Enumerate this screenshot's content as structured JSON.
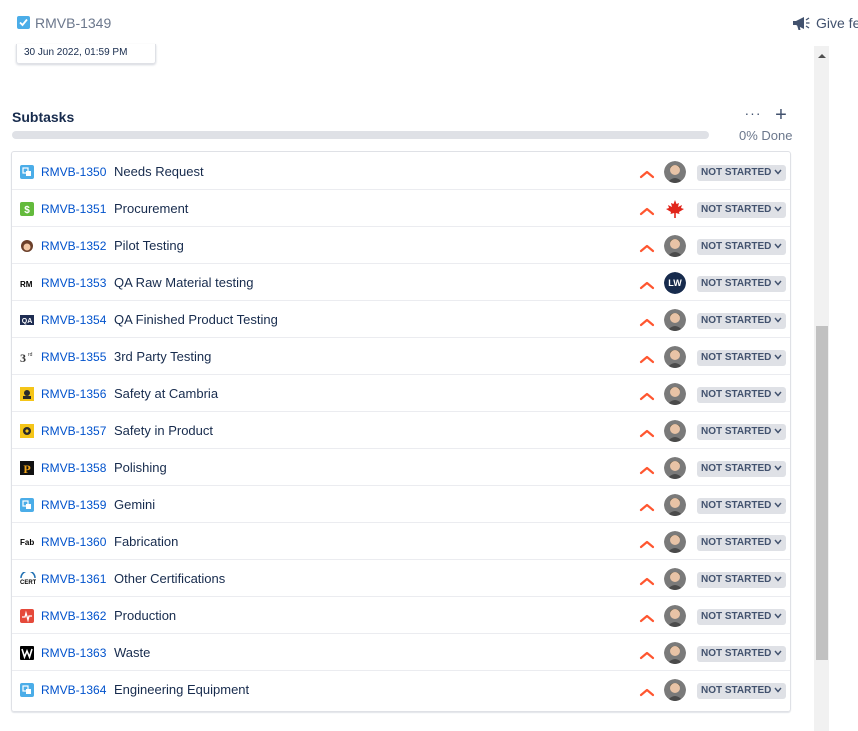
{
  "parent": {
    "key": "RMVB-1349",
    "icon": "checkbox-icon",
    "color": "#4bade8"
  },
  "header": {
    "feedback_label": "Give fee"
  },
  "date_field": {
    "value": "30 Jun 2022, 01:59 PM"
  },
  "subtasks": {
    "title": "Subtasks",
    "more_label": "···",
    "add_label": "+",
    "progress_percent": 0,
    "progress_label": "0% Done",
    "status_color": "#dfe1e6",
    "priority_color": "#ff5630",
    "items": [
      {
        "key": "RMVB-1350",
        "summary": "Needs Request",
        "icon": "subtask-icon",
        "assignee": "avatar",
        "status": "NOT STARTED"
      },
      {
        "key": "RMVB-1351",
        "summary": "Procurement",
        "icon": "dollar-icon",
        "assignee": "canada-flag",
        "status": "NOT STARTED"
      },
      {
        "key": "RMVB-1352",
        "summary": "Pilot Testing",
        "icon": "pilot-icon",
        "assignee": "avatar",
        "status": "NOT STARTED"
      },
      {
        "key": "RMVB-1353",
        "summary": "QA Raw Material testing",
        "icon": "rm-icon",
        "assignee": "LW",
        "status": "NOT STARTED"
      },
      {
        "key": "RMVB-1354",
        "summary": "QA Finished Product Testing",
        "icon": "qa-icon",
        "assignee": "avatar",
        "status": "NOT STARTED"
      },
      {
        "key": "RMVB-1355",
        "summary": "3rd Party Testing",
        "icon": "third-party-icon",
        "assignee": "avatar",
        "status": "NOT STARTED"
      },
      {
        "key": "RMVB-1356",
        "summary": "Safety at Cambria",
        "icon": "safety-icon",
        "assignee": "avatar",
        "status": "NOT STARTED"
      },
      {
        "key": "RMVB-1357",
        "summary": "Safety in Product",
        "icon": "safety-product-icon",
        "assignee": "avatar",
        "status": "NOT STARTED"
      },
      {
        "key": "RMVB-1358",
        "summary": "Polishing",
        "icon": "p-icon",
        "assignee": "avatar",
        "status": "NOT STARTED"
      },
      {
        "key": "RMVB-1359",
        "summary": "Gemini",
        "icon": "subtask-icon",
        "assignee": "avatar",
        "status": "NOT STARTED"
      },
      {
        "key": "RMVB-1360",
        "summary": "Fabrication",
        "icon": "fab-icon",
        "assignee": "avatar",
        "status": "NOT STARTED"
      },
      {
        "key": "RMVB-1361",
        "summary": "Other Certifications",
        "icon": "cert-icon",
        "assignee": "avatar",
        "status": "NOT STARTED"
      },
      {
        "key": "RMVB-1362",
        "summary": "Production",
        "icon": "production-icon",
        "assignee": "avatar",
        "status": "NOT STARTED"
      },
      {
        "key": "RMVB-1363",
        "summary": "Waste",
        "icon": "w-icon",
        "assignee": "avatar",
        "status": "NOT STARTED"
      },
      {
        "key": "RMVB-1364",
        "summary": "Engineering Equipment",
        "icon": "subtask-icon",
        "assignee": "avatar",
        "status": "NOT STARTED"
      }
    ]
  }
}
